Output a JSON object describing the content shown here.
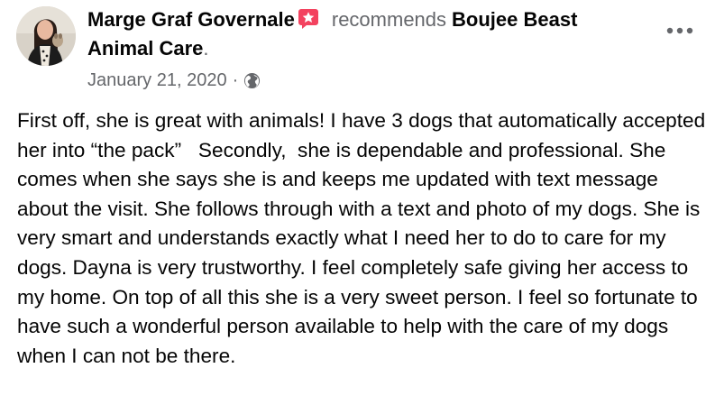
{
  "post": {
    "author": "Marge Graf Governale",
    "badge_icon": "star-badge-icon",
    "badge_color": "#f3425f",
    "action": "recommends",
    "page_name": "Boujee Beast Animal Care",
    "period": ".",
    "date": "January 21, 2020",
    "separator": "·",
    "privacy_icon": "globe-icon",
    "more_icon": "more-options-icon",
    "body": "First off, she is great with animals! I have 3 dogs that automatically accepted her into “the pack”   Secondly,  she is dependable and professional. She comes when she says she is and keeps me updated with text message about the visit. She follows through with a text and photo of my dogs. She is very smart and understands exactly what I need her to do to care for my dogs. Dayna is very trustworthy. I feel completely safe giving her access to my home. On top of all this she is a very sweet person. I feel so fortunate to have such a wonderful person available to help with the care of my dogs when I can not be there."
  }
}
